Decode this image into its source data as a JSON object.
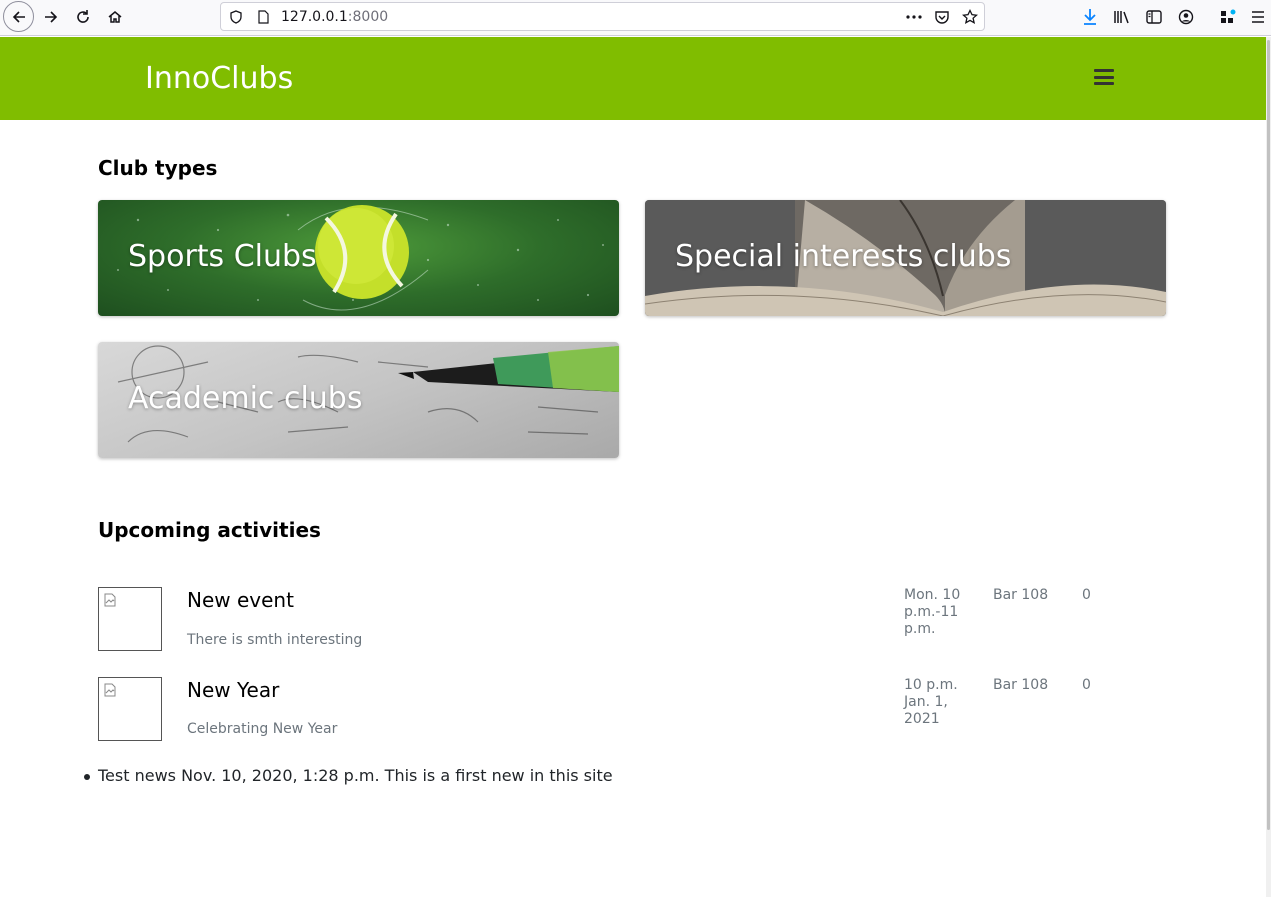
{
  "browser": {
    "url_host": "127.0.0.1",
    "url_port": ":8000"
  },
  "header": {
    "brand": "InnoClubs"
  },
  "club_types": {
    "title": "Club types",
    "cards": [
      {
        "label": "Sports Clubs"
      },
      {
        "label": "Special interests clubs"
      },
      {
        "label": "Academic clubs"
      }
    ]
  },
  "activities": {
    "title": "Upcoming activities",
    "items": [
      {
        "title": "New event",
        "description": "There is smth interesting",
        "time": "Mon. 10 p.m.-11 p.m.",
        "place": "Bar 108",
        "count": "0"
      },
      {
        "title": "New Year",
        "description": "Celebrating New Year",
        "time": "10 p.m. Jan. 1, 2021",
        "place": "Bar 108",
        "count": "0"
      }
    ]
  },
  "news": {
    "items": [
      {
        "text": "Test news Nov. 10, 2020, 1:28 p.m. This is a first new in this site"
      }
    ]
  },
  "colors": {
    "header_bg": "#80bd00",
    "muted_text": "#6c757d"
  }
}
